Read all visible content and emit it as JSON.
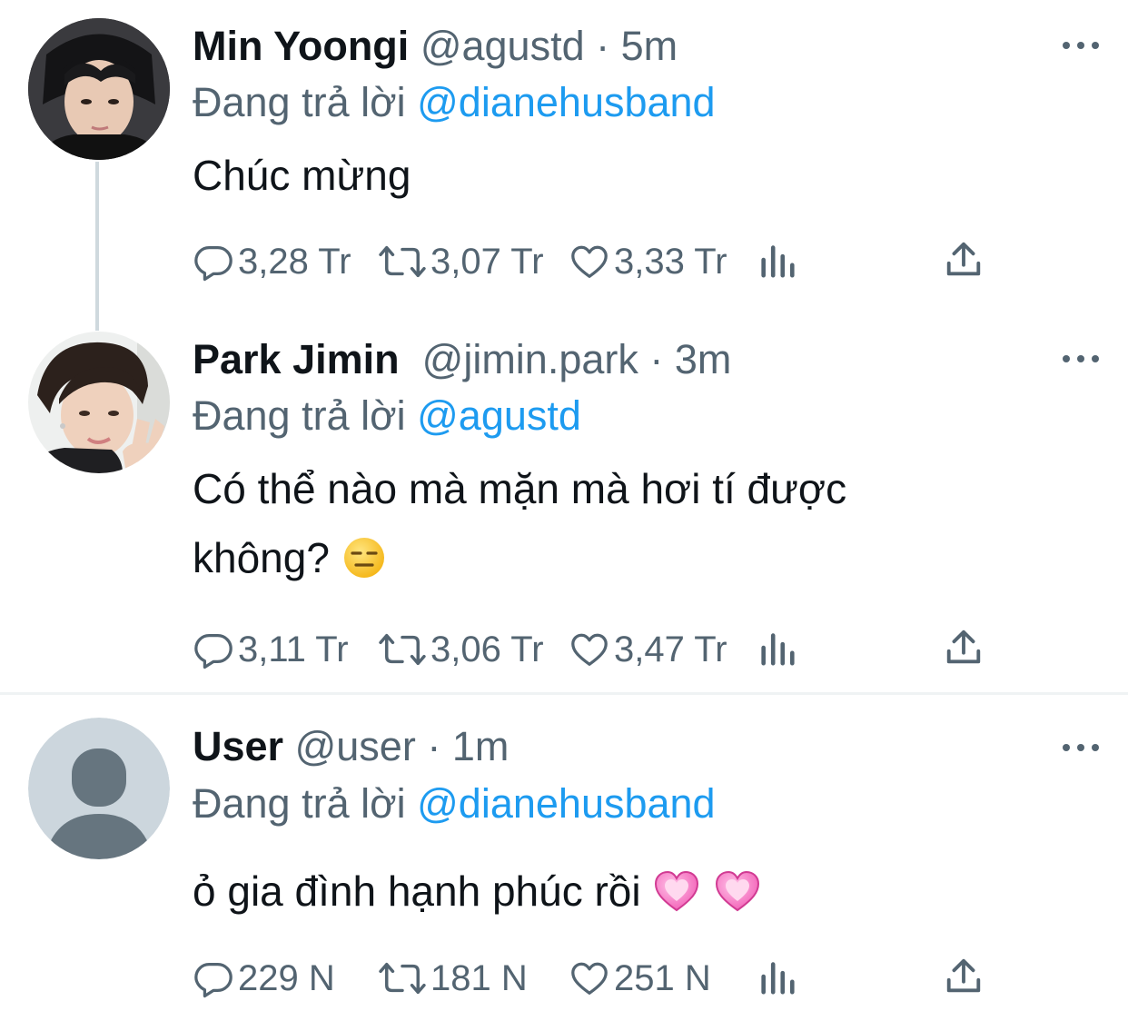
{
  "tweets": [
    {
      "name": "Min Yoongi",
      "handle": "@agustd",
      "separator": "·",
      "time": "5m",
      "reply_prefix": "Đang trả lời",
      "reply_to": "@dianehusband",
      "text_lines": [
        "Chúc mừng"
      ],
      "stats": {
        "replies": "3,28 Tr",
        "retweets": "3,07 Tr",
        "likes": "3,33 Tr"
      }
    },
    {
      "name": "Park Jimin",
      "handle": "@jimin.park",
      "separator": "·",
      "time": "3m",
      "reply_prefix": "Đang trả lời",
      "reply_to": "@agustd",
      "text_lines": [
        "Có thể nào mà mặn mà hơi tí được",
        "không?"
      ],
      "stats": {
        "replies": "3,11 Tr",
        "retweets": "3,06 Tr",
        "likes": "3,47 Tr"
      }
    },
    {
      "name": "User",
      "handle": "@user",
      "separator": "·",
      "time": "1m",
      "reply_prefix": "Đang trả lời",
      "reply_to": "@dianehusband",
      "text_lines": [
        "ỏ gia đình hạnh phúc rồi"
      ],
      "stats": {
        "replies": "229 N",
        "retweets": "181 N",
        "likes": "251 N"
      }
    }
  ],
  "icons": {
    "reply": "speech-bubble-icon",
    "retweet": "retweet-icon",
    "like": "heart-icon",
    "views": "bar-chart-icon",
    "share": "share-icon",
    "more": "more-dots-icon",
    "neutral_emoji": "expressionless-face-emoji",
    "heart_emoji": "growing-heart-emoji"
  },
  "colors": {
    "text": "#0f1419",
    "secondary": "#536471",
    "link": "#1d9bf0",
    "thread_line": "#cfd9de",
    "divider": "#eff3f4"
  }
}
